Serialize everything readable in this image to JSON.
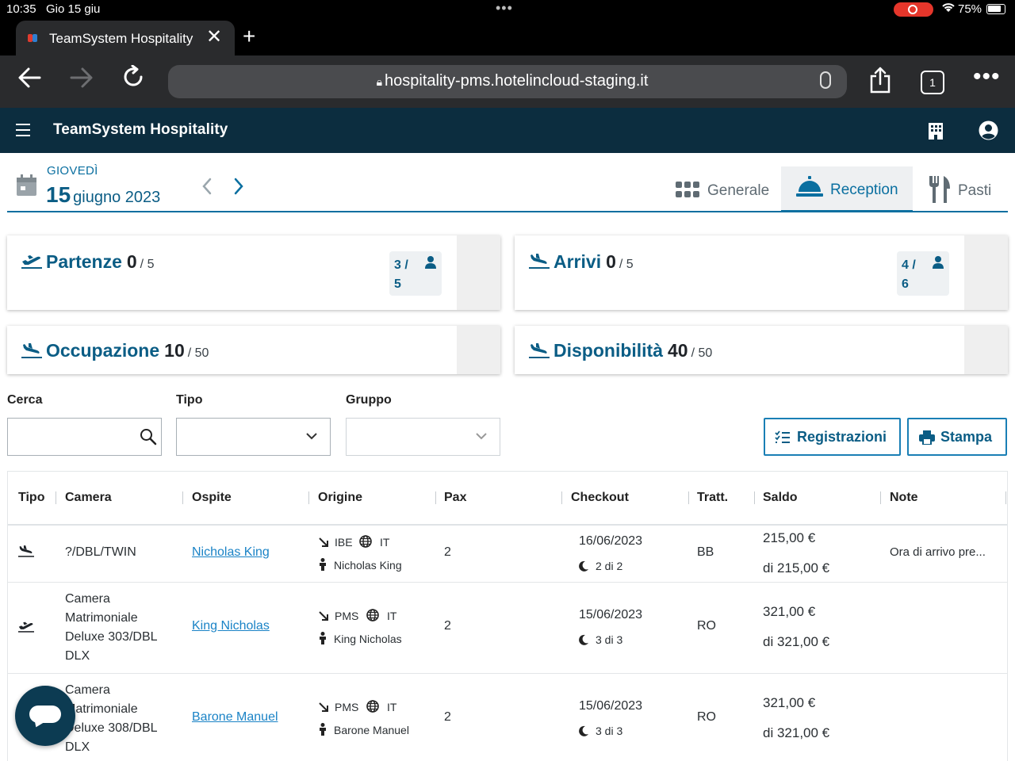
{
  "status_bar": {
    "time": "10:35",
    "date": "Gio 15 giu",
    "battery": "75%"
  },
  "browser": {
    "tab_title": "TeamSystem Hospitality",
    "url": "hospitality-pms.hotelincloud-staging.it",
    "tab_count": "1"
  },
  "app": {
    "title": "TeamSystem Hospitality"
  },
  "date_header": {
    "weekday": "GIOVEDÌ",
    "day": "15",
    "month_year": "giugno 2023"
  },
  "view_tabs": {
    "generale": "Generale",
    "reception": "Reception",
    "pasti": "Pasti",
    "active": "Reception"
  },
  "cards": {
    "partenze": {
      "title": "Partenze",
      "value": "0",
      "total": "/ 5",
      "pax_top": "3 /",
      "pax_bottom": "5"
    },
    "arrivi": {
      "title": "Arrivi",
      "value": "0",
      "total": "/ 5",
      "pax_top": "4 /",
      "pax_bottom": "6"
    },
    "occupazione": {
      "title": "Occupazione",
      "value": "10",
      "total": "/ 50"
    },
    "disponibilita": {
      "title": "Disponibilità",
      "value": "40",
      "total": "/ 50"
    }
  },
  "filters": {
    "cerca_label": "Cerca",
    "cerca_value": "",
    "tipo_label": "Tipo",
    "tipo_value": "",
    "gruppo_label": "Gruppo",
    "gruppo_value": ""
  },
  "buttons": {
    "registrazioni": "Registrazioni",
    "stampa": "Stampa"
  },
  "table": {
    "columns": [
      "Tipo",
      "Camera",
      "Ospite",
      "Origine",
      "Pax",
      "Checkout",
      "Tratt.",
      "Saldo",
      "Note"
    ],
    "rows": [
      {
        "tipo_icon": "arrival-plane-icon",
        "camera": [
          "?/DBL/TWIN"
        ],
        "ospite": "Nicholas King",
        "origine_channel": "IBE",
        "origine_country": "IT",
        "origine_guest": "Nicholas King",
        "pax": "2",
        "checkout_date": "16/06/2023",
        "checkout_nights": "2 di 2",
        "tratt": "BB",
        "saldo": "215,00 €",
        "saldo_total": "di 215,00 €",
        "note": "Ora di arrivo pre..."
      },
      {
        "tipo_icon": "departure-plane-icon",
        "camera": [
          "Camera",
          "Matrimoniale",
          "Deluxe 303/DBL",
          "DLX"
        ],
        "ospite": "King Nicholas",
        "origine_channel": "PMS",
        "origine_country": "IT",
        "origine_guest": "King Nicholas",
        "pax": "2",
        "checkout_date": "15/06/2023",
        "checkout_nights": "3 di 3",
        "tratt": "RO",
        "saldo": "321,00 €",
        "saldo_total": "di 321,00 €",
        "note": ""
      },
      {
        "tipo_icon": "departure-plane-icon",
        "camera": [
          "Camera",
          "Matrimoniale",
          "Deluxe 308/DBL",
          "DLX"
        ],
        "ospite": "Barone Manuel",
        "origine_channel": "PMS",
        "origine_country": "IT",
        "origine_guest": "Barone Manuel",
        "pax": "2",
        "checkout_date": "15/06/2023",
        "checkout_nights": "3 di 3",
        "tratt": "RO",
        "saldo": "321,00 €",
        "saldo_total": "di 321,00 €",
        "note": ""
      }
    ]
  },
  "colors": {
    "primary": "#0b5d85",
    "header_bg": "#0c2d3f",
    "link": "#1a83c6"
  }
}
